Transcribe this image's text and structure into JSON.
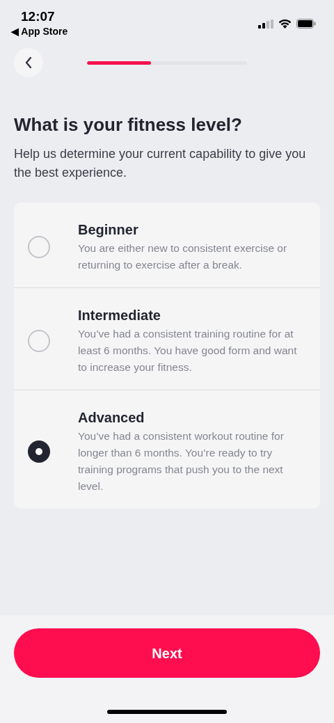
{
  "status_bar": {
    "time": "12:07",
    "back_app": "◀ App Store"
  },
  "progress": {
    "level": 0.4
  },
  "title": "What is your fitness level?",
  "subtitle": "Help us determine your current capability to give you the best experience.",
  "options": [
    {
      "title": "Beginner",
      "description": "You are either new to consistent exercise or returning to exercise after a break.",
      "selected": false
    },
    {
      "title": "Intermediate",
      "description": "You’ve had a consistent training routine for at least 6 months. You have good form and want to increase your fitness.",
      "selected": false
    },
    {
      "title": "Advanced",
      "description": "You’ve had a consistent workout routine for longer than 6 months. You’re ready to try training programs that push you to the next level.",
      "selected": true
    }
  ],
  "next_button": "Next"
}
